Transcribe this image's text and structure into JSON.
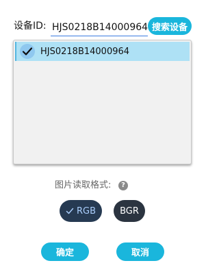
{
  "device_id": {
    "label": "设备ID:",
    "value": "HJS0218B14000964",
    "search_label": "搜索设备"
  },
  "device_list": {
    "items": [
      {
        "label": "HJS0218B14000964",
        "selected": true,
        "icon": "checkmark-icon"
      }
    ]
  },
  "image_format": {
    "label": "图片读取格式:",
    "help_icon": "?",
    "options": [
      {
        "label": "RGB",
        "selected": true
      },
      {
        "label": "BGR",
        "selected": false
      }
    ]
  },
  "actions": {
    "ok_label": "确定",
    "cancel_label": "取消"
  },
  "colors": {
    "accent": "#1ab6dc",
    "selection": "#aee1f5",
    "format_selected_bg": "#263a52",
    "format_bg": "#2b3440"
  }
}
